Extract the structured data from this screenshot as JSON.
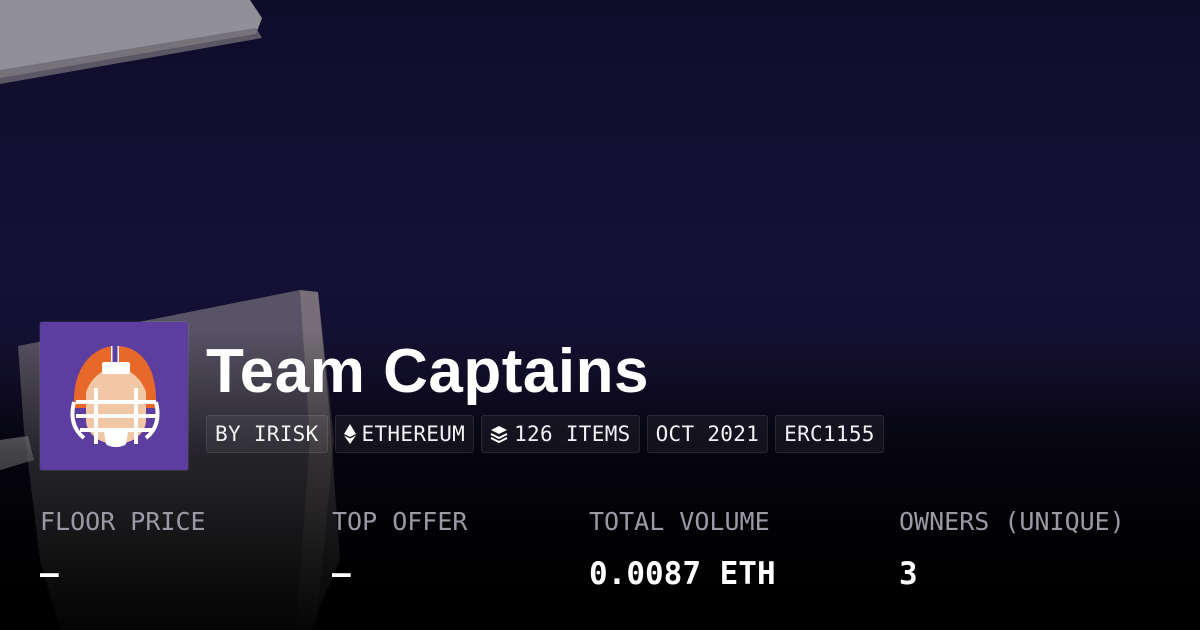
{
  "collection": {
    "title": "Team Captains",
    "tags": [
      {
        "text": "BY IRISK",
        "icon": ""
      },
      {
        "text": "ETHEREUM",
        "icon": "ethereum-icon"
      },
      {
        "text": "126 ITEMS",
        "icon": "layers-icon"
      },
      {
        "text": "OCT 2021",
        "icon": ""
      },
      {
        "text": "ERC1155",
        "icon": ""
      }
    ]
  },
  "stats": [
    {
      "label": "FLOOR PRICE",
      "value": "—"
    },
    {
      "label": "TOP OFFER",
      "value": "—"
    },
    {
      "label": "TOTAL VOLUME",
      "value": "0.0087 ETH"
    },
    {
      "label": "OWNERS (UNIQUE)",
      "value": "3"
    }
  ],
  "colors": {
    "background": "#13102e",
    "avatar_bg": "#5b3e9f",
    "helmet_orange": "#e8682a",
    "label_gray": "#9a9aa6",
    "text_white": "#ffffff"
  }
}
